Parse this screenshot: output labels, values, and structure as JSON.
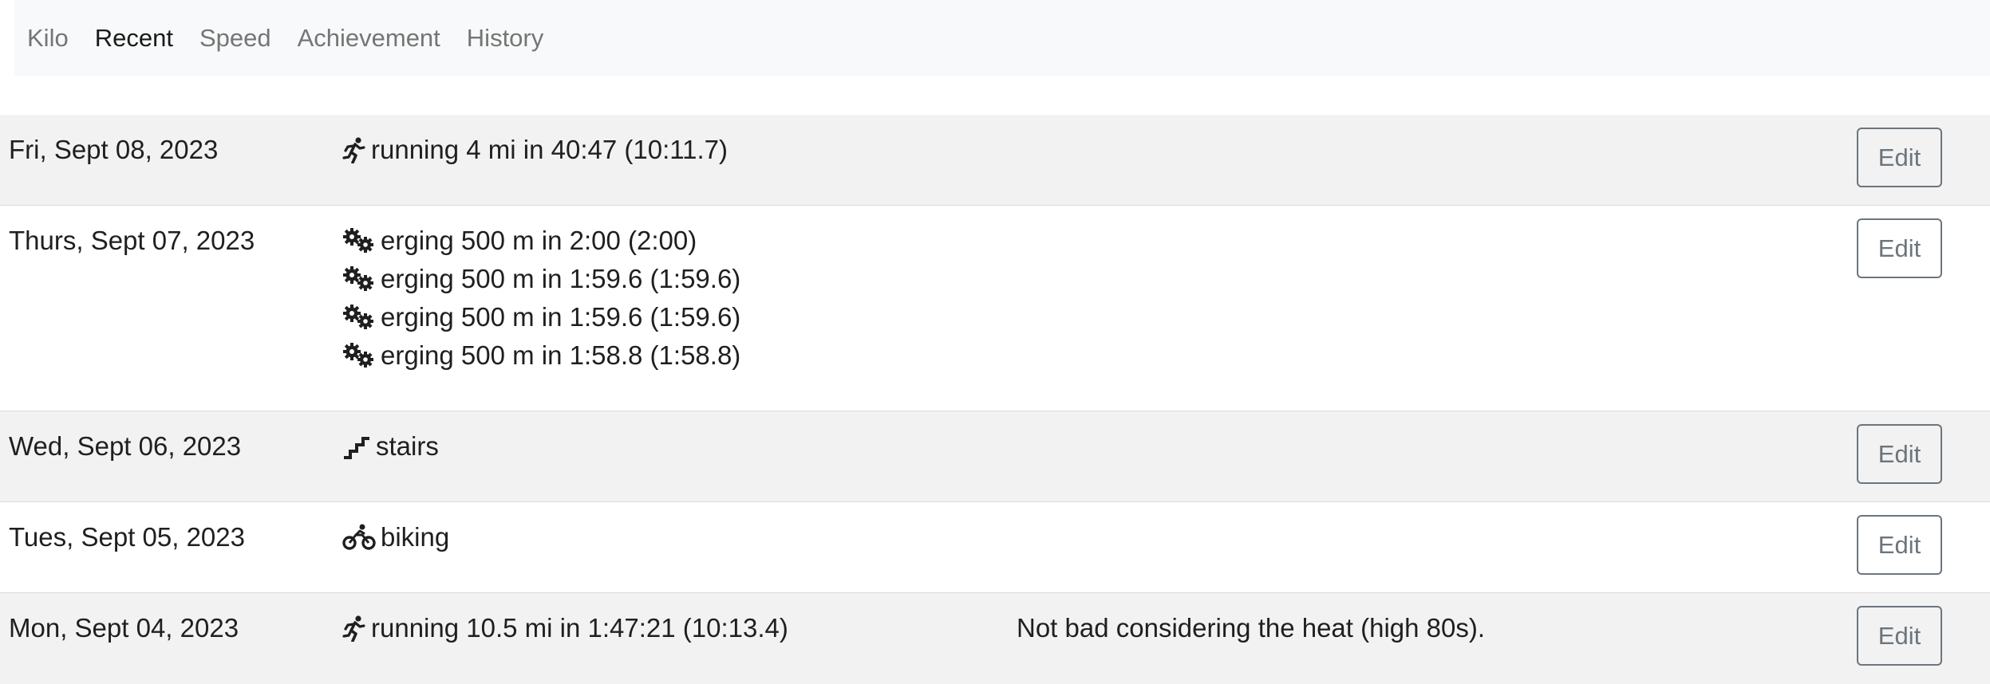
{
  "nav": {
    "items": [
      {
        "label": "Kilo",
        "active": false
      },
      {
        "label": "Recent",
        "active": true
      },
      {
        "label": "Speed",
        "active": false
      },
      {
        "label": "Achievement",
        "active": false
      },
      {
        "label": "History",
        "active": false
      }
    ]
  },
  "edit_label": "Edit",
  "rows": [
    {
      "date": "Fri, Sept 08, 2023",
      "activities": [
        {
          "icon": "running-icon",
          "text": "running 4 mi in 40:47 (10:11.7)"
        }
      ],
      "note": ""
    },
    {
      "date": "Thurs, Sept 07, 2023",
      "activities": [
        {
          "icon": "gears-icon",
          "text": "erging 500 m in 2:00 (2:00)"
        },
        {
          "icon": "gears-icon",
          "text": "erging 500 m in 1:59.6 (1:59.6)"
        },
        {
          "icon": "gears-icon",
          "text": "erging 500 m in 1:59.6 (1:59.6)"
        },
        {
          "icon": "gears-icon",
          "text": "erging 500 m in 1:58.8 (1:58.8)"
        }
      ],
      "note": ""
    },
    {
      "date": "Wed, Sept 06, 2023",
      "activities": [
        {
          "icon": "stairs-icon",
          "text": "stairs"
        }
      ],
      "note": ""
    },
    {
      "date": "Tues, Sept 05, 2023",
      "activities": [
        {
          "icon": "bicycle-icon",
          "text": "biking"
        }
      ],
      "note": ""
    },
    {
      "date": "Mon, Sept 04, 2023",
      "activities": [
        {
          "icon": "running-icon",
          "text": "running 10.5 mi in 1:47:21 (10:13.4)"
        }
      ],
      "note": "Not bad considering the heat (high 80s)."
    }
  ]
}
